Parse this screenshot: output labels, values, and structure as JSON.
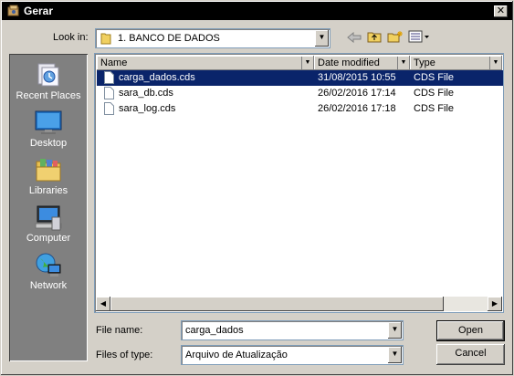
{
  "window": {
    "title": "Gerar",
    "close_glyph": "✕"
  },
  "toolbar": {
    "look_in_label": "Look in:",
    "look_in_value": "1. BANCO DE DADOS",
    "icons": [
      "back-arrow-icon",
      "up-folder-icon",
      "new-folder-icon",
      "view-menu-icon"
    ]
  },
  "places": [
    {
      "label": "Recent Places",
      "icon": "recent-places-icon"
    },
    {
      "label": "Desktop",
      "icon": "desktop-icon"
    },
    {
      "label": "Libraries",
      "icon": "libraries-icon"
    },
    {
      "label": "Computer",
      "icon": "computer-icon"
    },
    {
      "label": "Network",
      "icon": "network-icon"
    }
  ],
  "list": {
    "columns": [
      "Name",
      "Date modified",
      "Type"
    ],
    "files": [
      {
        "name": "carga_dados.cds",
        "date": "31/08/2015 10:55",
        "type": "CDS File",
        "selected": true
      },
      {
        "name": "sara_db.cds",
        "date": "26/02/2016 17:14",
        "type": "CDS File",
        "selected": false
      },
      {
        "name": "sara_log.cds",
        "date": "26/02/2016 17:18",
        "type": "CDS File",
        "selected": false
      }
    ]
  },
  "form": {
    "file_name_label": "File name:",
    "file_name_value": "carga_dados",
    "file_type_label": "Files of type:",
    "file_type_value": "Arquivo de Atualização"
  },
  "buttons": {
    "open": "Open",
    "cancel": "Cancel"
  },
  "colors": {
    "selection": "#0a246a",
    "titlebar": "#000000",
    "face": "#d4d0c8",
    "places_bg": "#808080"
  }
}
